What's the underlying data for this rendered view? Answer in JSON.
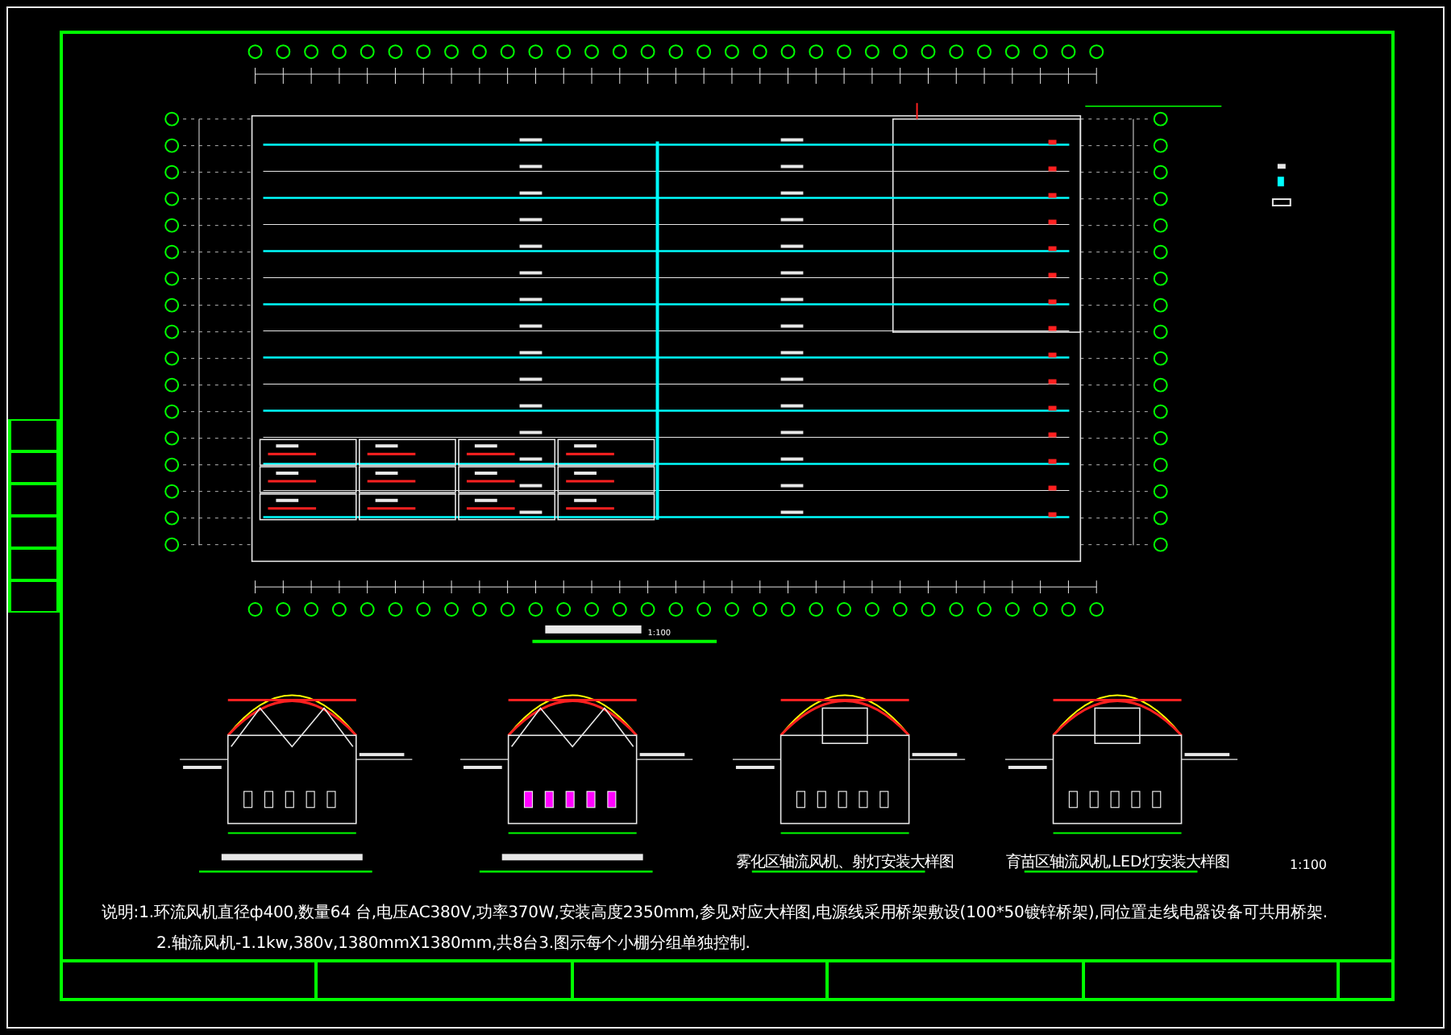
{
  "plan": {
    "scale": "1:100"
  },
  "details": [
    {
      "kind": "circulation"
    },
    {
      "kind": "circulation"
    },
    {
      "kind": "axial",
      "title": "雾化区轴流风机、射灯安装大样图"
    },
    {
      "kind": "axial",
      "title": "育苗区轴流风机,LED灯安装大样图"
    }
  ],
  "notes": [
    "说明:1.环流风机直径ф400,数量64 台,电压AC380V,功率370W,安装高度2350mm,参见对应大样图,电源线采用桥架敷设(100*50镀锌桥架),同位置走线电器设备可共用桥架.",
    "2.轴流风机-1.1kw,380v,1380mmX1380mm,共8台3.图示每个小棚分组单独控制."
  ],
  "title_block": {
    "scale": "1:100"
  }
}
